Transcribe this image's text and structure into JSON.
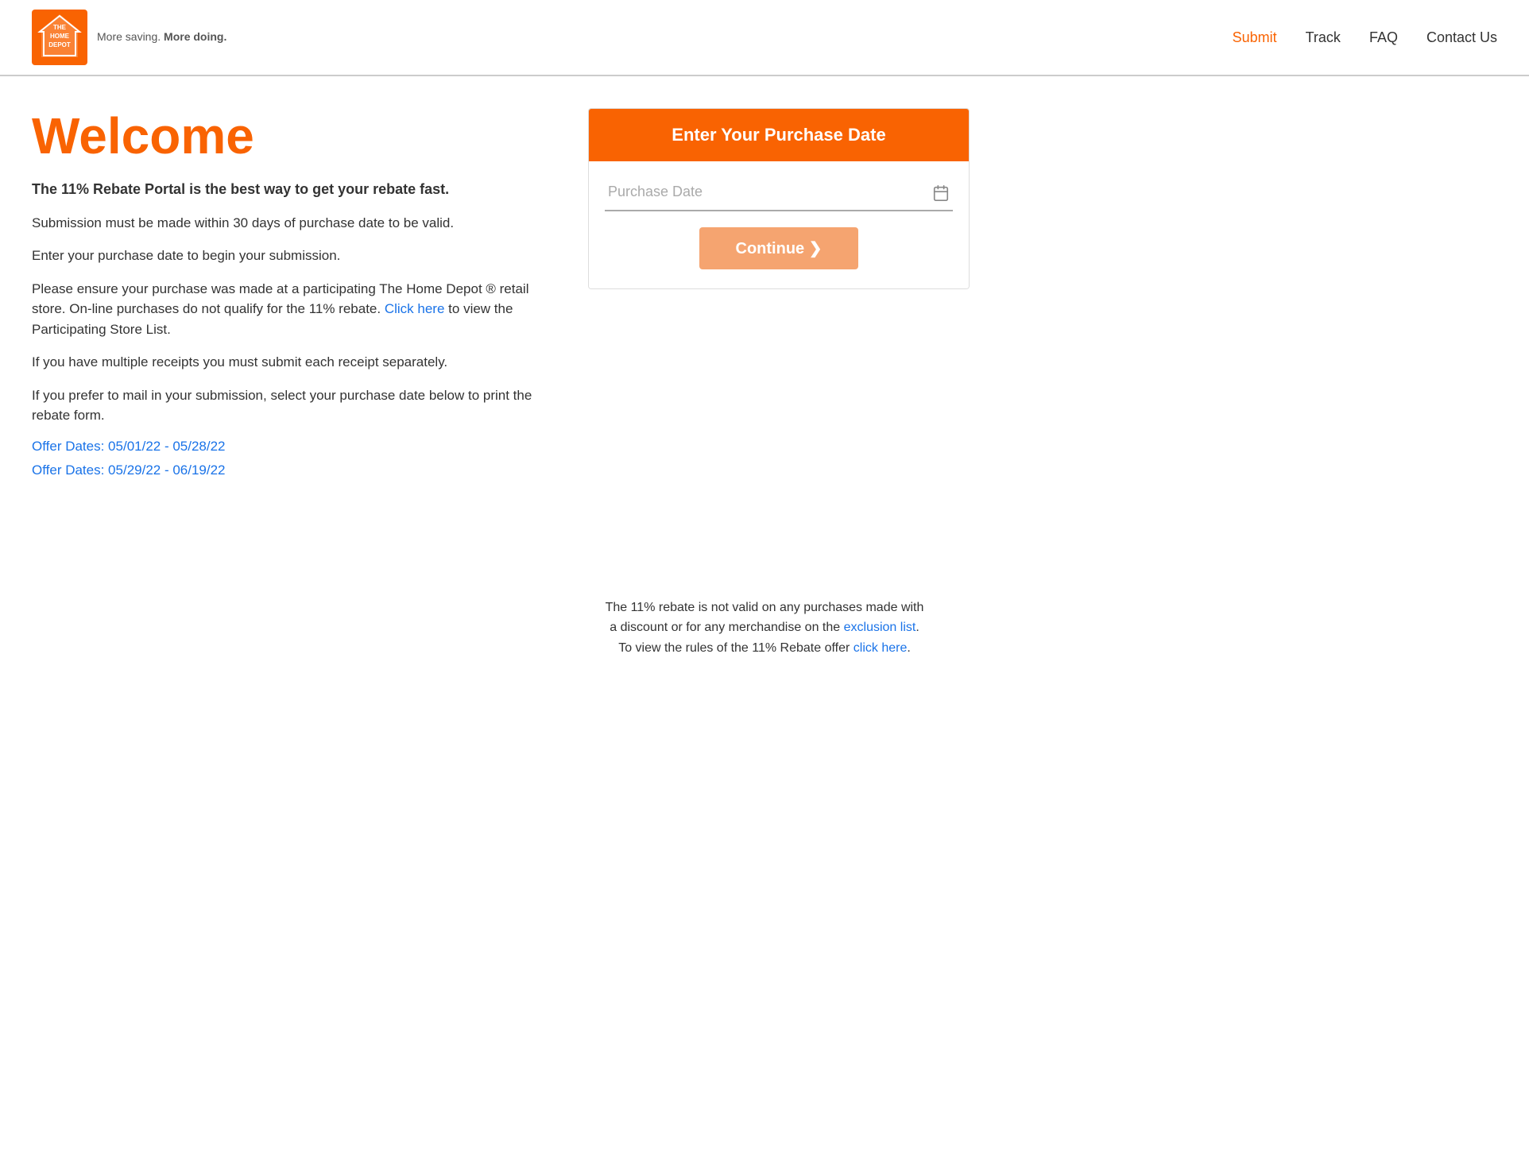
{
  "header": {
    "logo_text": "THE\nHOME\nDEPOT",
    "tagline": "More saving. ",
    "tagline_bold": "More doing.",
    "nav": {
      "submit_label": "Submit",
      "track_label": "Track",
      "faq_label": "FAQ",
      "contact_label": "Contact Us"
    }
  },
  "main": {
    "welcome_heading": "Welcome",
    "subtitle": "The 11% Rebate Portal is the best way to get your rebate fast.",
    "para1": "Submission must be made within 30 days of purchase date to be valid.",
    "para2": "Enter your purchase date to begin your submission.",
    "para3_before": "Please ensure your purchase was made at a participating The Home Depot ® retail store. On-line purchases do not qualify for the 11% rebate.",
    "para3_link_text": "Click here",
    "para3_after": " to view the Participating Store List.",
    "para4": "If you have multiple receipts you must submit each receipt separately.",
    "para5": "If you prefer to mail in your submission, select your purchase date below to print the rebate form.",
    "offer1": "Offer Dates: 05/01/22 - 05/28/22",
    "offer2": "Offer Dates: 05/29/22 - 06/19/22"
  },
  "panel": {
    "header": "Enter Your Purchase Date",
    "date_placeholder": "Purchase Date",
    "continue_label": "Continue ❯",
    "calendar_icon": "📅"
  },
  "bottom_note": {
    "line1": "The 11% rebate is not valid on any purchases made with",
    "line2_before": "a discount or for any merchandise on the ",
    "line2_link": "exclusion list",
    "line2_after": ".",
    "line3_before": "To view the rules of the 11% Rebate offer ",
    "line3_link": "click here",
    "line3_after": "."
  },
  "colors": {
    "orange": "#f96302",
    "orange_light": "#f5a470",
    "blue_link": "#1a73e8"
  }
}
